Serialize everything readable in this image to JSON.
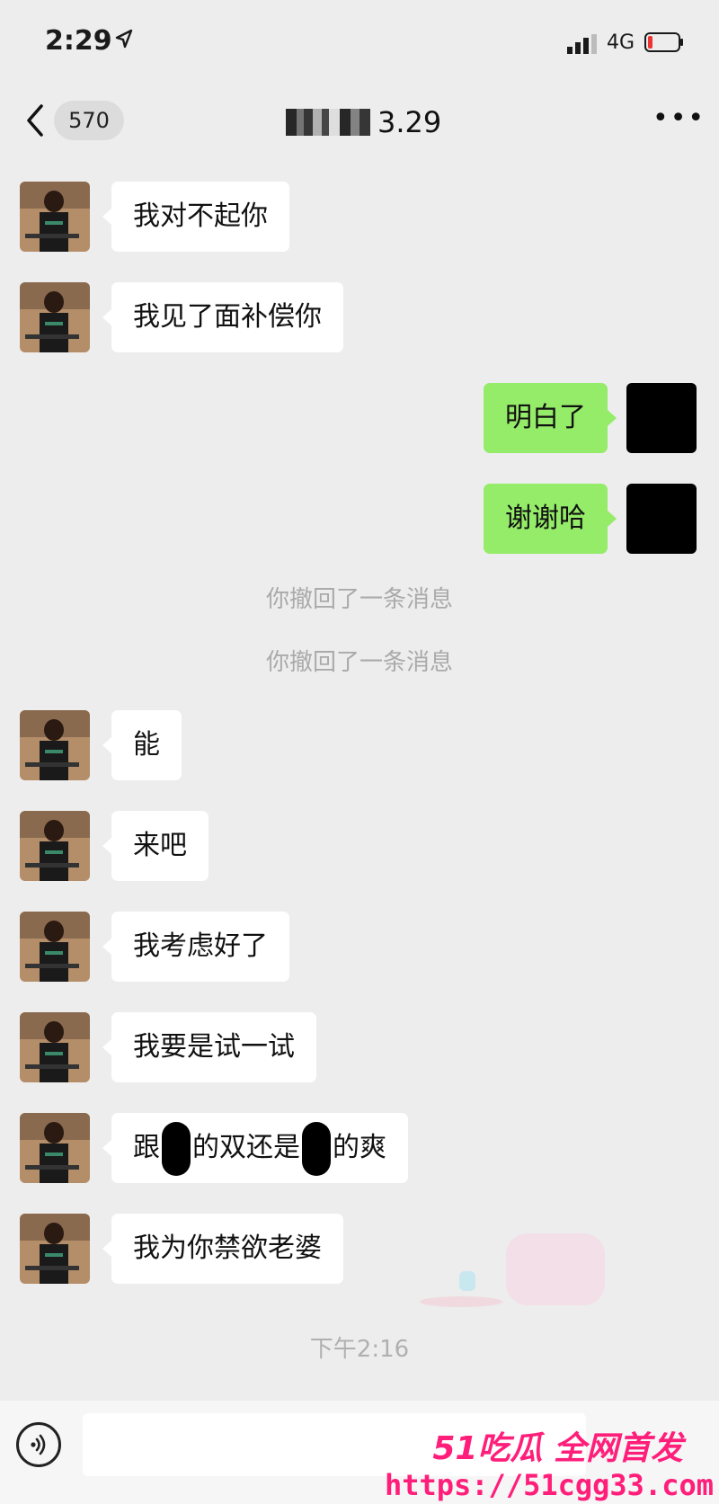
{
  "status_bar": {
    "time": "2:29",
    "network": "4G",
    "icons": [
      "location-arrow-icon",
      "signal-icon",
      "battery-low-icon"
    ]
  },
  "nav": {
    "back_icon": "chevron-left-icon",
    "unread_count": "570",
    "title_visible_text": "3.29",
    "more_icon": "ellipsis-icon"
  },
  "messages": [
    {
      "side": "in",
      "text": "我对不起你"
    },
    {
      "side": "in",
      "text": "我见了面补偿你"
    },
    {
      "side": "out",
      "text": "明白了"
    },
    {
      "side": "out",
      "text": "谢谢哈"
    },
    {
      "side": "system",
      "text": "你撤回了一条消息"
    },
    {
      "side": "system",
      "text": "你撤回了一条消息"
    },
    {
      "side": "in",
      "text": "能"
    },
    {
      "side": "in",
      "text": "来吧"
    },
    {
      "side": "in",
      "text": "我考虑好了"
    },
    {
      "side": "in",
      "text": "我要是试一试"
    },
    {
      "side": "in",
      "parts": [
        "跟",
        "的双还是",
        "的爽"
      ]
    },
    {
      "side": "in",
      "text": "我为你禁欲老婆"
    },
    {
      "side": "system",
      "text": "下午2:16"
    }
  ],
  "input_bar": {
    "voice_icon": "voice-icon"
  },
  "watermark": {
    "brand": "51吃瓜 全网首发",
    "url": "https://51cgg33.com"
  },
  "colors": {
    "background": "#ededed",
    "outgoing_bubble": "#95ec69",
    "incoming_bubble": "#ffffff",
    "system_text": "#aaaaaa",
    "watermark": "#ff1e7a"
  }
}
